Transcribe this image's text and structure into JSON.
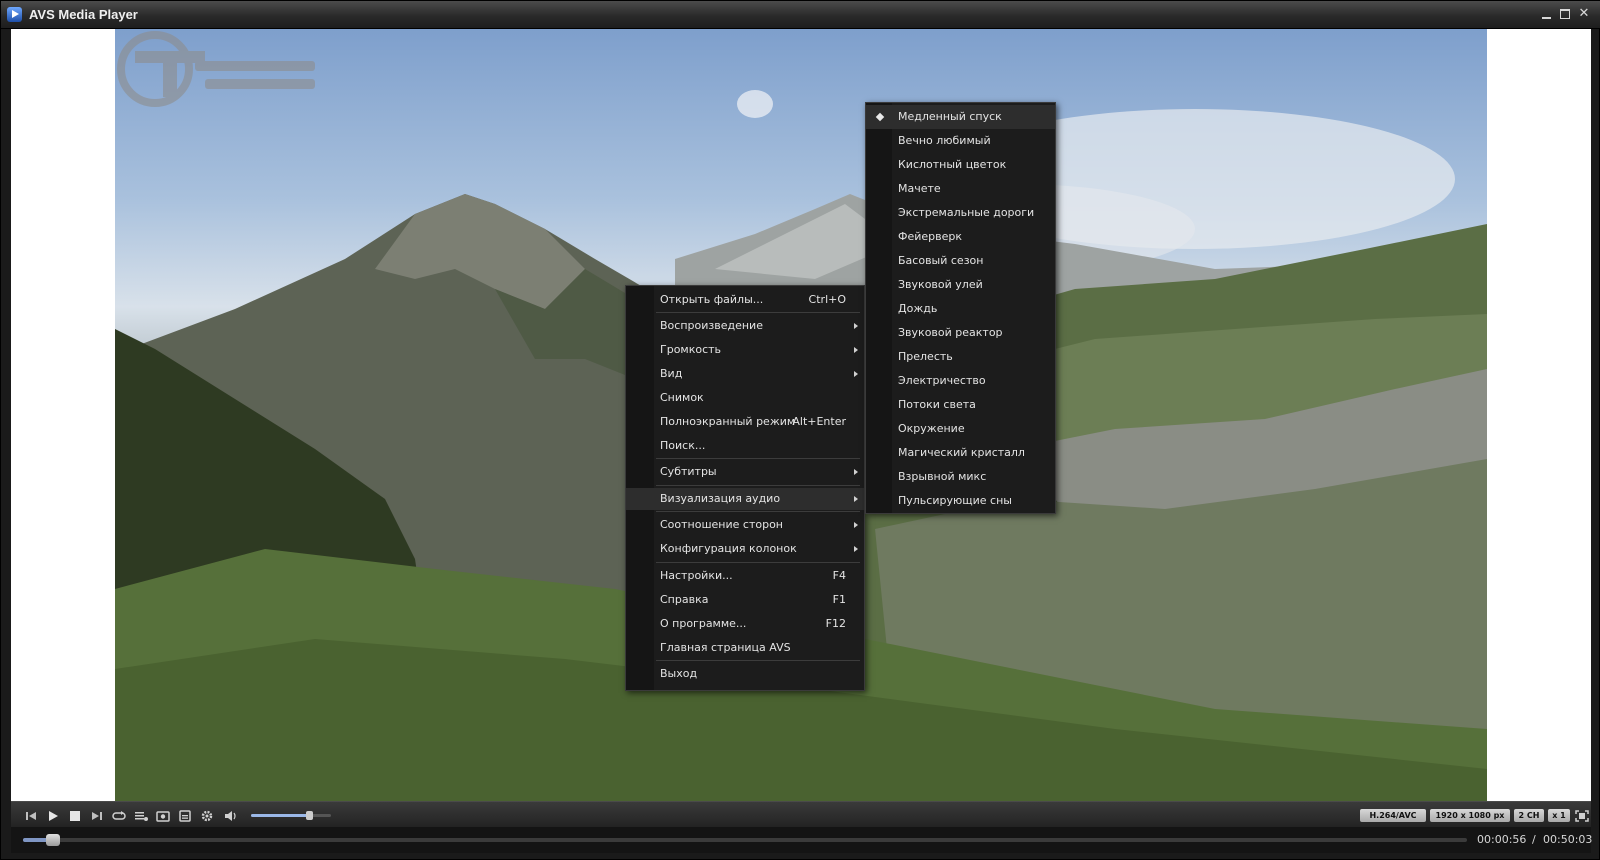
{
  "window": {
    "title": "AVS Media Player",
    "minimize_icon": "minimize-icon",
    "maximize_icon": "maximize-icon",
    "close_glyph": "✕"
  },
  "video": {
    "watermark": "Travel logo"
  },
  "context_menu": {
    "items": [
      {
        "label": "Открыть файлы...",
        "shortcut": "Ctrl+O",
        "submenu": false
      },
      {
        "label": "Воспроизведение",
        "shortcut": "",
        "submenu": true
      },
      {
        "label": "Громкость",
        "shortcut": "",
        "submenu": true
      },
      {
        "label": "Вид",
        "shortcut": "",
        "submenu": true
      },
      {
        "label": "Снимок",
        "shortcut": "",
        "submenu": false
      },
      {
        "label": "Полноэкранный режим",
        "shortcut": "Alt+Enter",
        "submenu": false
      },
      {
        "label": "Поиск...",
        "shortcut": "",
        "submenu": false
      },
      {
        "label": "Субтитры",
        "shortcut": "",
        "submenu": true
      },
      {
        "label": "Визуализация аудио",
        "shortcut": "",
        "submenu": true,
        "active": true
      },
      {
        "label": "Соотношение сторон",
        "shortcut": "",
        "submenu": true
      },
      {
        "label": "Конфигурация колонок",
        "shortcut": "",
        "submenu": true
      },
      {
        "label": "Настройки...",
        "shortcut": "F4",
        "submenu": false
      },
      {
        "label": "Справка",
        "shortcut": "F1",
        "submenu": false
      },
      {
        "label": "О программе...",
        "shortcut": "F12",
        "submenu": false
      },
      {
        "label": "Главная страница AVS",
        "shortcut": "",
        "submenu": false
      },
      {
        "label": "Выход",
        "shortcut": "",
        "submenu": false
      }
    ]
  },
  "visualization_submenu": {
    "selected": "Медленный спуск",
    "items": [
      "Медленный спуск",
      "Вечно любимый",
      "Кислотный цветок",
      "Мачете",
      "Экстремальные дороги",
      "Фейерверк",
      "Басовый сезон",
      "Звуковой улей",
      "Дождь",
      "Звуковой реактор",
      "Прелесть",
      "Электричество",
      "Потоки света",
      "Окружение",
      "Магический кристалл",
      "Взрывной микс",
      "Пульсирующие сны"
    ]
  },
  "controls": {
    "buttons": [
      "previous-icon",
      "play-icon",
      "stop-icon",
      "next-icon",
      "repeat-icon",
      "playlist-icon",
      "snapshot-icon",
      "subtitles-icon",
      "settings-icon",
      "volume-icon"
    ],
    "volume_level": 0.72,
    "badges": {
      "codec": "H.264/AVC",
      "resolution": "1920 x 1080 px",
      "channels": "2 CH",
      "speed": "x 1"
    },
    "fullscreen_icon": "fullscreen-icon"
  },
  "seek": {
    "current_time": "00:00:56",
    "separator": "/",
    "total_time": "00:50:03",
    "progress": 0.0187
  }
}
